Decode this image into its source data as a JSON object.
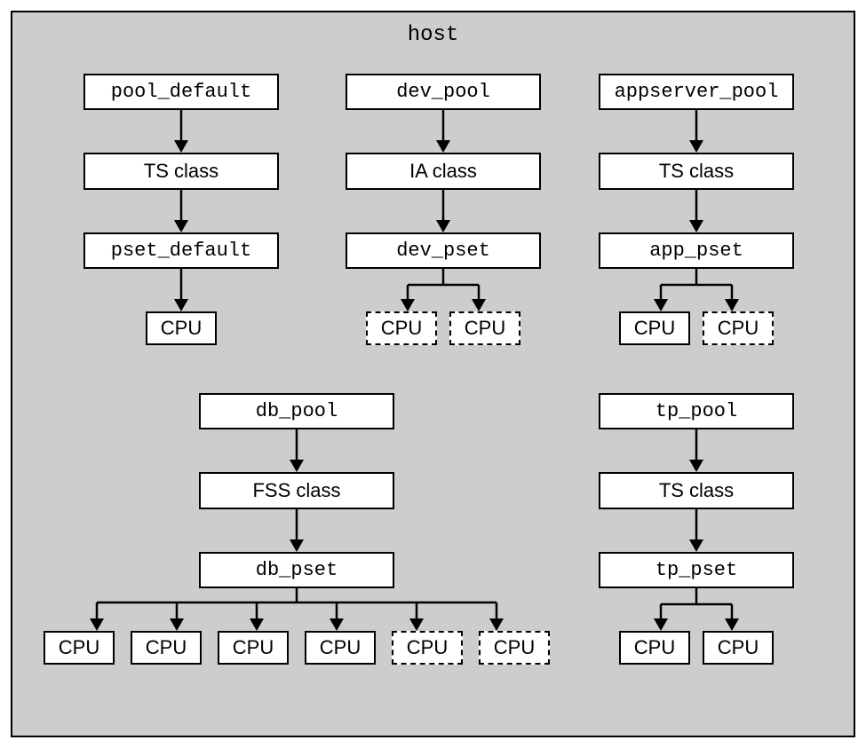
{
  "host_label": "host",
  "pools": [
    {
      "name": "pool_default",
      "class": "TS class",
      "pset": "pset_default",
      "cpus": [
        {
          "dashed": false
        }
      ]
    },
    {
      "name": "dev_pool",
      "class": "IA class",
      "pset": "dev_pset",
      "cpus": [
        {
          "dashed": true
        },
        {
          "dashed": true
        }
      ]
    },
    {
      "name": "appserver_pool",
      "class": "TS class",
      "pset": "app_pset",
      "cpus": [
        {
          "dashed": false
        },
        {
          "dashed": true
        }
      ]
    },
    {
      "name": "db_pool",
      "class": "FSS class",
      "pset": "db_pset",
      "cpus": [
        {
          "dashed": false
        },
        {
          "dashed": false
        },
        {
          "dashed": false
        },
        {
          "dashed": false
        },
        {
          "dashed": true
        },
        {
          "dashed": true
        }
      ]
    },
    {
      "name": "tp_pool",
      "class": "TS class",
      "pset": "tp_pset",
      "cpus": [
        {
          "dashed": false
        },
        {
          "dashed": false
        }
      ]
    }
  ],
  "cpu_label": "CPU"
}
